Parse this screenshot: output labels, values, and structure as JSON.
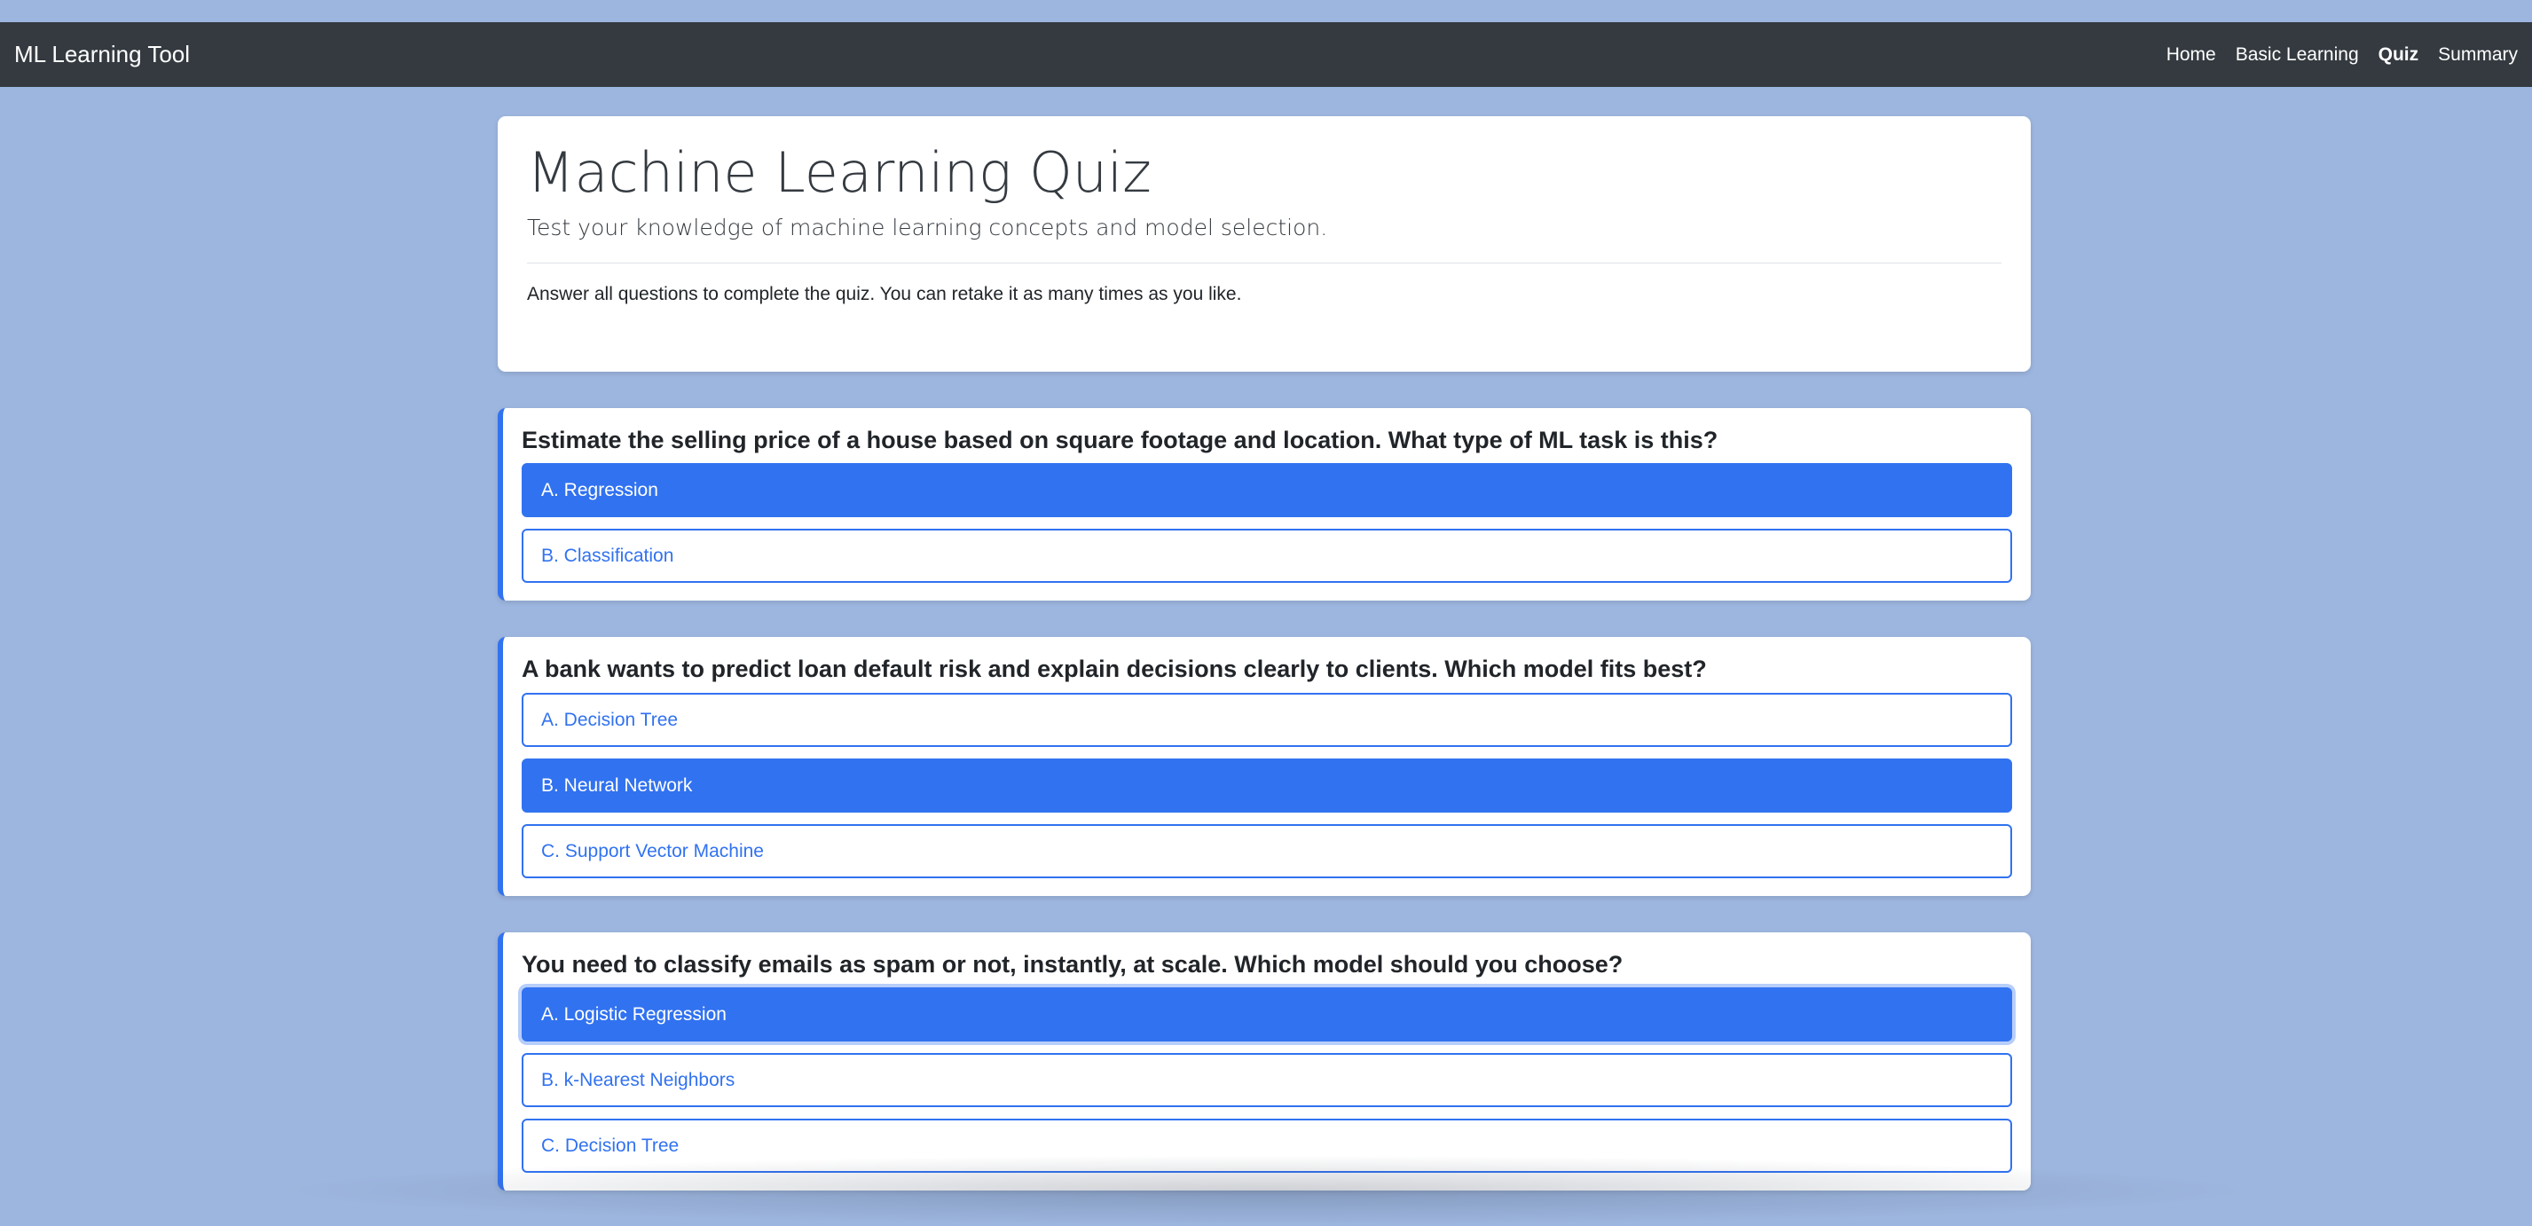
{
  "navbar": {
    "brand": "ML Learning Tool",
    "links": [
      "Home",
      "Basic Learning",
      "Quiz",
      "Summary"
    ],
    "active": "Quiz"
  },
  "intro": {
    "title": "Machine Learning Quiz",
    "lead": "Test your knowledge of machine learning concepts and model selection.",
    "note": "Answer all questions to complete the quiz. You can retake it as many times as you like."
  },
  "questions": [
    {
      "text": "Estimate the selling price of a house based on square footage and location. What type of ML task is this?",
      "options": [
        "A. Regression",
        "B. Classification"
      ],
      "selected": "A. Regression"
    },
    {
      "text": "A bank wants to predict loan default risk and explain decisions clearly to clients. Which model fits best?",
      "options": [
        "A. Decision Tree",
        "B. Neural Network",
        "C. Support Vector Machine"
      ],
      "selected": "B. Neural Network"
    },
    {
      "text": "You need to classify emails as spam or not, instantly, at scale. Which model should you choose?",
      "options": [
        "A. Logistic Regression",
        "B. k-Nearest Neighbors",
        "C. Decision Tree"
      ],
      "selected": "A. Logistic Regression"
    }
  ],
  "colors": {
    "background": "#9db6df",
    "navbar": "#343a40",
    "accent": "#3172f0"
  }
}
